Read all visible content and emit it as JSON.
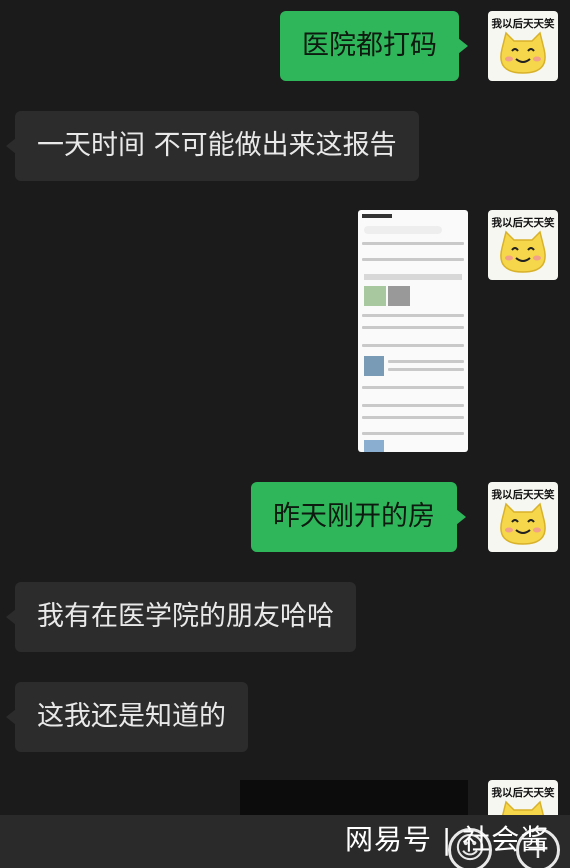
{
  "messages": [
    {
      "direction": "out",
      "text": "医院都打码"
    },
    {
      "direction": "in",
      "text": "一天时间 不可能做出来这报告"
    },
    {
      "direction": "out",
      "type": "image",
      "description": "phone screenshot"
    },
    {
      "direction": "out",
      "text": "昨天刚开的房"
    },
    {
      "direction": "in",
      "text": "我有在医学院的朋友哈哈"
    },
    {
      "direction": "in",
      "text": "这我还是知道的"
    },
    {
      "direction": "out",
      "type": "image"
    }
  ],
  "avatar": {
    "caption": "我以后天天笑"
  },
  "watermark": "网易号 | 社会酱",
  "bottom_bar": {
    "emoji_button": "☺",
    "add_button": "+"
  }
}
